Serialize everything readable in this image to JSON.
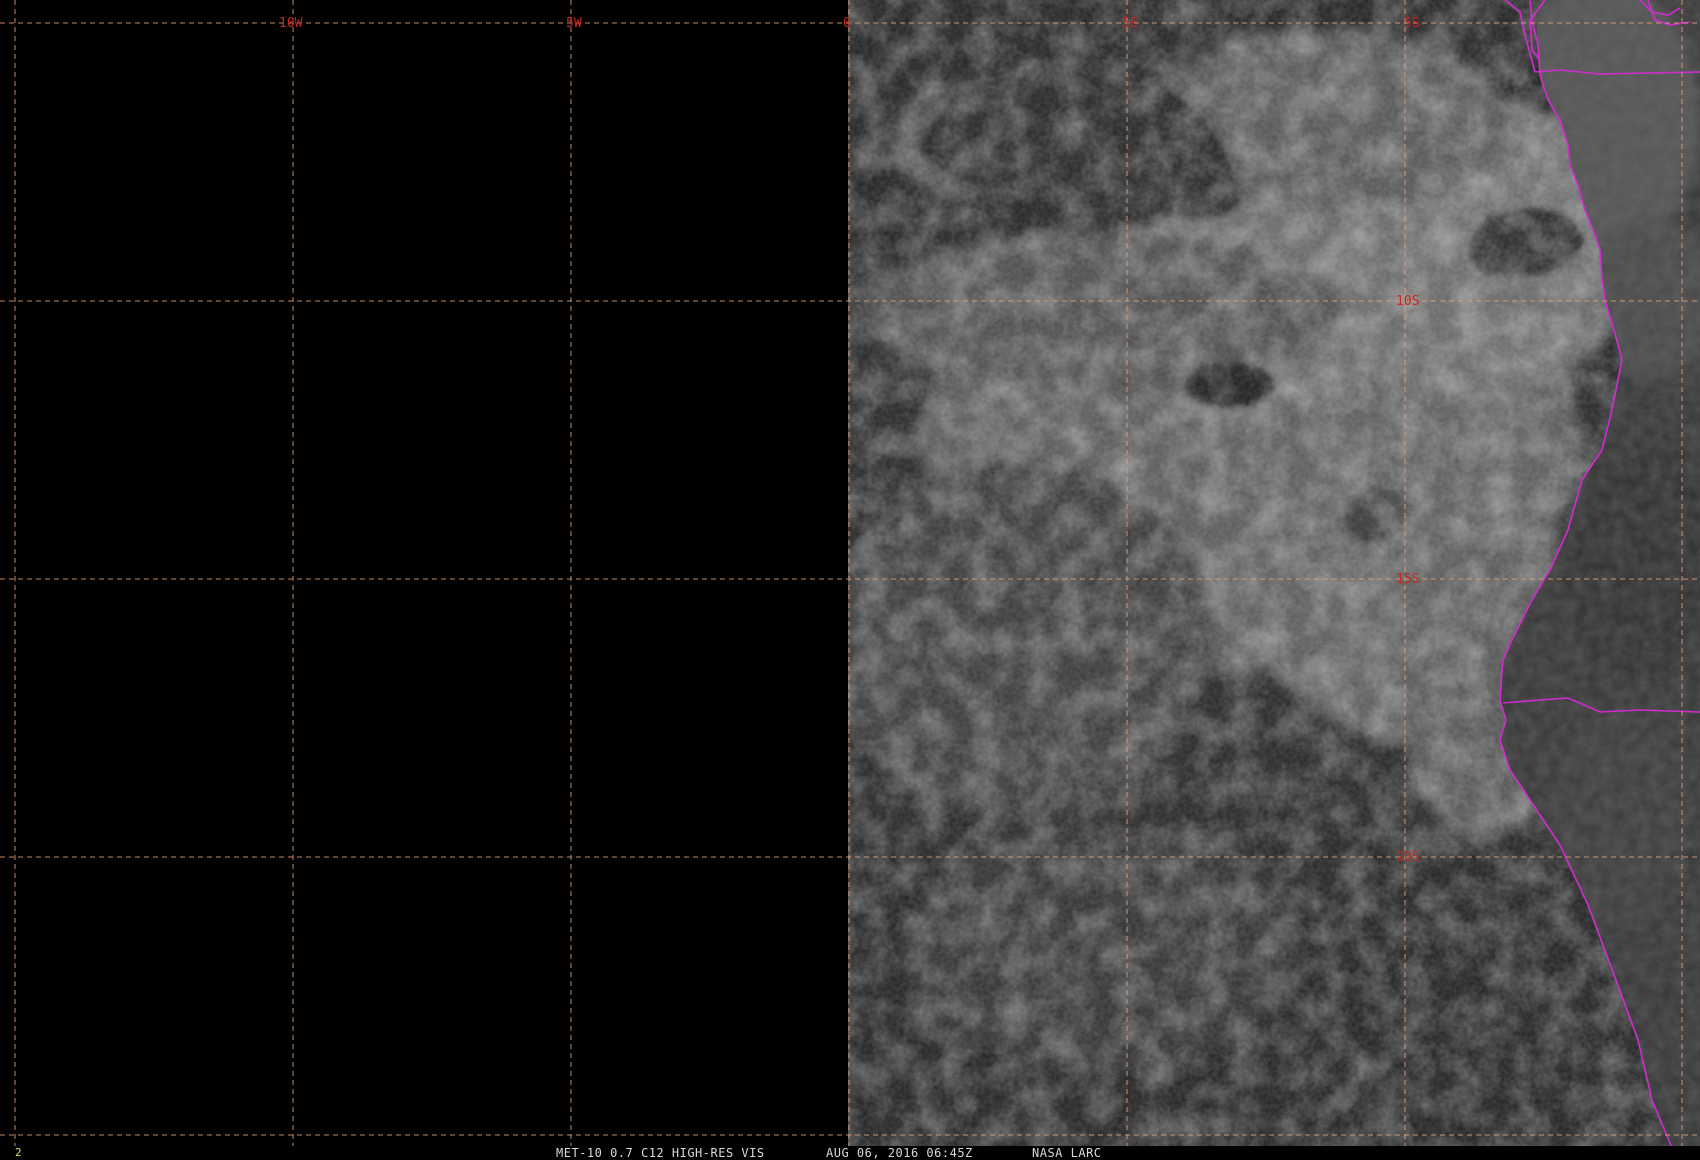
{
  "graticule": {
    "longitude_labels": [
      "10W",
      "5W",
      "0",
      "5E",
      "5S"
    ],
    "latitude_labels": [
      "10S",
      "15S",
      "20S"
    ],
    "line_color": "#e8a276",
    "label_color": "#c8261e"
  },
  "boundaries": {
    "color": "#d22bd2"
  },
  "status_bar": {
    "frame_number": "2",
    "product": "MET-10 0.7 C12 HIGH-RES VIS",
    "datetime": "AUG 06, 2016 06:45Z",
    "source": "NASA LARC"
  }
}
